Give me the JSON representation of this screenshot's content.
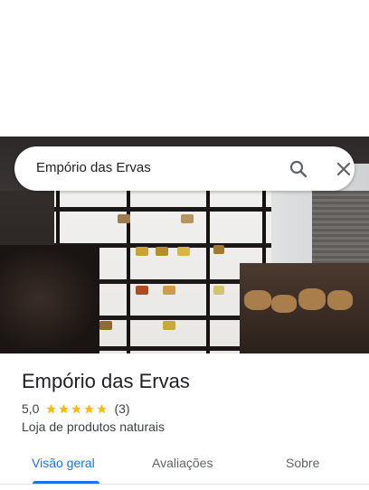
{
  "search": {
    "value": "Empório das Ervas"
  },
  "place": {
    "name": "Empório das Ervas",
    "rating_text": "5,0",
    "rating_value": 5,
    "review_count_text": "(3)",
    "category": "Loja de produtos naturais"
  },
  "tabs": [
    {
      "label": "Visão geral",
      "active": true
    },
    {
      "label": "Avaliações",
      "active": false
    },
    {
      "label": "Sobre",
      "active": false
    }
  ],
  "icons": {
    "search": "search-icon",
    "close": "close-icon",
    "star": "star-icon"
  },
  "colors": {
    "accent": "#1a73e8",
    "star": "#fbbc04",
    "text_primary": "#202124",
    "text_secondary": "#3c4043"
  }
}
